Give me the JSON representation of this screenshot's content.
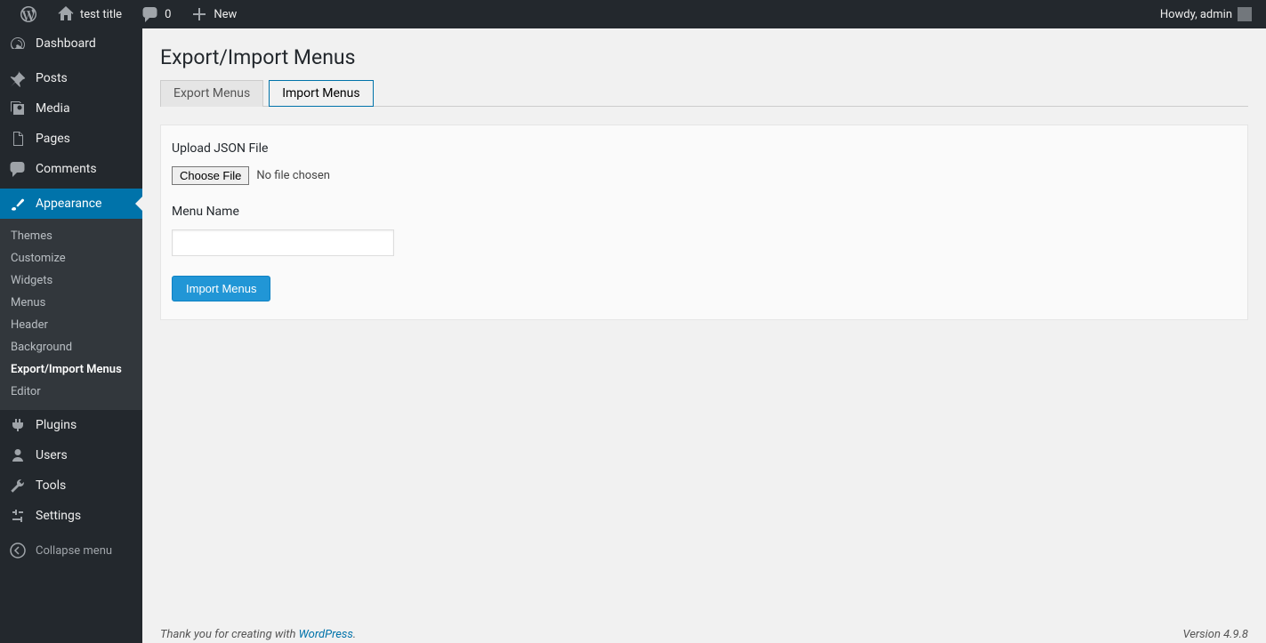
{
  "adminbar": {
    "site_title": "test title",
    "comments_count": "0",
    "new_label": "New",
    "howdy": "Howdy, admin"
  },
  "sidebar": {
    "items": [
      {
        "label": "Dashboard",
        "icon": "dashboard"
      },
      {
        "label": "Posts",
        "icon": "pin"
      },
      {
        "label": "Media",
        "icon": "media"
      },
      {
        "label": "Pages",
        "icon": "page"
      },
      {
        "label": "Comments",
        "icon": "comment"
      },
      {
        "label": "Appearance",
        "icon": "brush",
        "active": true
      },
      {
        "label": "Plugins",
        "icon": "plug"
      },
      {
        "label": "Users",
        "icon": "user"
      },
      {
        "label": "Tools",
        "icon": "wrench"
      },
      {
        "label": "Settings",
        "icon": "sliders"
      }
    ],
    "submenu": [
      "Themes",
      "Customize",
      "Widgets",
      "Menus",
      "Header",
      "Background",
      "Export/Import Menus",
      "Editor"
    ],
    "collapse": "Collapse menu"
  },
  "page": {
    "title": "Export/Import Menus",
    "tabs": {
      "export": "Export Menus",
      "import": "Import Menus"
    },
    "panel": {
      "upload_label": "Upload JSON File",
      "choose_file": "Choose File",
      "no_file": "No file chosen",
      "menu_name_label": "Menu Name",
      "import_button": "Import Menus"
    }
  },
  "footer": {
    "thanks_prefix": "Thank you for creating with ",
    "wp_link": "WordPress",
    "thanks_suffix": ".",
    "version": "Version 4.9.8"
  }
}
